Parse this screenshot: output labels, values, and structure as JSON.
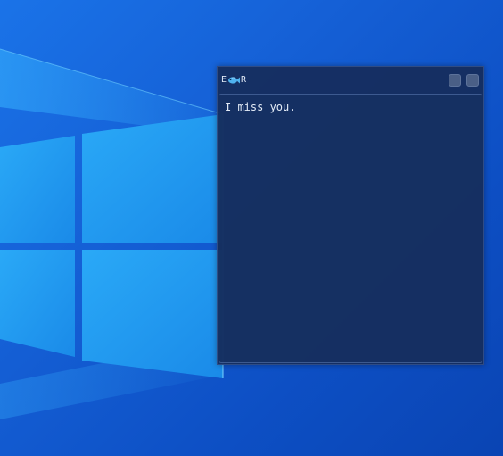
{
  "desktop": {
    "background_color": "#1565d8",
    "logo_color": "#1ea0f5"
  },
  "note_window": {
    "title_prefix": "E",
    "title_suffix": "R",
    "title_icon": "fish-icon",
    "note_text": "I miss you.",
    "background_color": "#152d5c",
    "text_color": "#e4ecf7"
  }
}
